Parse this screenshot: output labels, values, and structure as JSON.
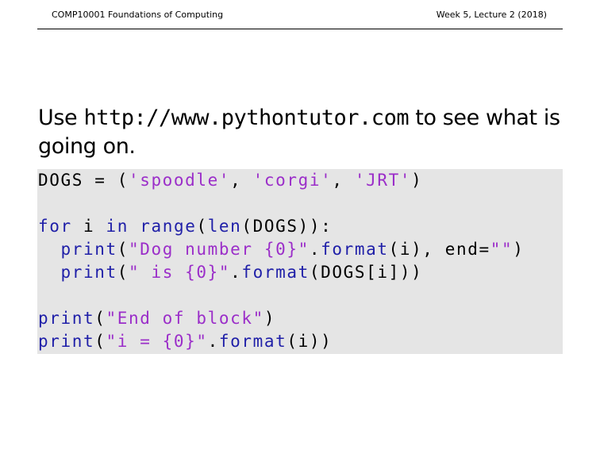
{
  "header": {
    "left": "COMP10001 Foundations of Computing",
    "right": "Week 5, Lecture 2 (2018)"
  },
  "body": {
    "text_before": "Use ",
    "url": "http://www.pythontutor.com",
    "text_after": " to see what is going on."
  },
  "code": {
    "line1": {
      "a": "DOGS = (",
      "b": "'spoodle'",
      "c": ", ",
      "d": "'corgi'",
      "e": ", ",
      "f": "'JRT'",
      "g": ")"
    },
    "line2": {
      "a": "for",
      "b": " i ",
      "c": "in",
      "d": " ",
      "e": "range",
      "f": "(",
      "g": "len",
      "h": "(DOGS)):"
    },
    "line3": {
      "a": "  ",
      "b": "print",
      "c": "(",
      "d": "\"Dog number {0}\"",
      "e": ".",
      "f": "format",
      "g": "(i), end=",
      "h": "\"\"",
      "i": ")"
    },
    "line4": {
      "a": "  ",
      "b": "print",
      "c": "(",
      "d": "\" is {0}\"",
      "e": ".",
      "f": "format",
      "g": "(DOGS[i]))"
    },
    "line5": {
      "a": "print",
      "b": "(",
      "c": "\"End of block\"",
      "d": ")"
    },
    "line6": {
      "a": "print",
      "b": "(",
      "c": "\"i = {0}\"",
      "d": ".",
      "e": "format",
      "f": "(i))"
    }
  },
  "colors": {
    "keyword": "#1f1fa8",
    "string": "#9b2ec9",
    "code_background": "#e5e5e5"
  }
}
